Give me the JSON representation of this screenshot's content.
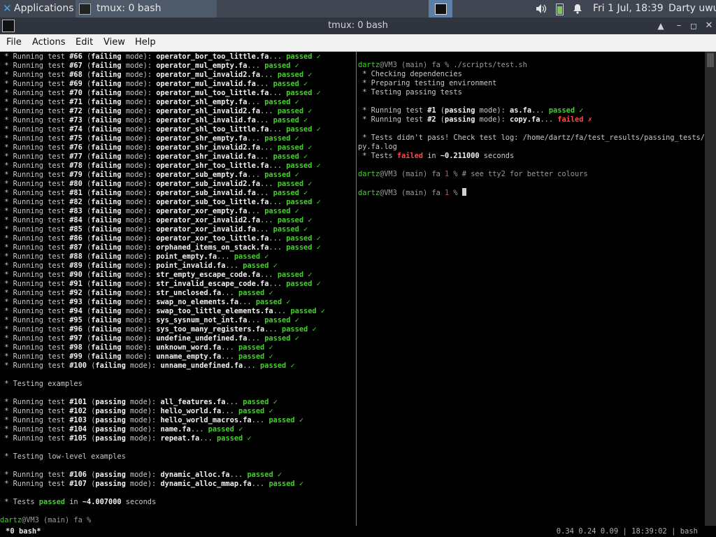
{
  "panel": {
    "apps_label": "Applications",
    "task_label": "tmux: 0 bash",
    "clock": "Fri  1 Jul, 18:39",
    "user": "Darty uwu"
  },
  "window": {
    "title": "tmux: 0 bash",
    "buttons": {
      "shade": "▲",
      "minimize": "–",
      "maximize": "◻",
      "close": "✕"
    }
  },
  "menu": [
    "File",
    "Actions",
    "Edit",
    "View",
    "Help"
  ],
  "left_pane": {
    "tests": [
      {
        "n": "66",
        "mode": "failing",
        "file": "operator_bor_too_little.fa"
      },
      {
        "n": "67",
        "mode": "failing",
        "file": "operator_mul_empty.fa"
      },
      {
        "n": "68",
        "mode": "failing",
        "file": "operator_mul_invalid2.fa"
      },
      {
        "n": "69",
        "mode": "failing",
        "file": "operator_mul_invalid.fa"
      },
      {
        "n": "70",
        "mode": "failing",
        "file": "operator_mul_too_little.fa"
      },
      {
        "n": "71",
        "mode": "failing",
        "file": "operator_shl_empty.fa"
      },
      {
        "n": "72",
        "mode": "failing",
        "file": "operator_shl_invalid2.fa"
      },
      {
        "n": "73",
        "mode": "failing",
        "file": "operator_shl_invalid.fa"
      },
      {
        "n": "74",
        "mode": "failing",
        "file": "operator_shl_too_little.fa"
      },
      {
        "n": "75",
        "mode": "failing",
        "file": "operator_shr_empty.fa"
      },
      {
        "n": "76",
        "mode": "failing",
        "file": "operator_shr_invalid2.fa"
      },
      {
        "n": "77",
        "mode": "failing",
        "file": "operator_shr_invalid.fa"
      },
      {
        "n": "78",
        "mode": "failing",
        "file": "operator_shr_too_little.fa"
      },
      {
        "n": "79",
        "mode": "failing",
        "file": "operator_sub_empty.fa"
      },
      {
        "n": "80",
        "mode": "failing",
        "file": "operator_sub_invalid2.fa"
      },
      {
        "n": "81",
        "mode": "failing",
        "file": "operator_sub_invalid.fa"
      },
      {
        "n": "82",
        "mode": "failing",
        "file": "operator_sub_too_little.fa"
      },
      {
        "n": "83",
        "mode": "failing",
        "file": "operator_xor_empty.fa"
      },
      {
        "n": "84",
        "mode": "failing",
        "file": "operator_xor_invalid2.fa"
      },
      {
        "n": "85",
        "mode": "failing",
        "file": "operator_xor_invalid.fa"
      },
      {
        "n": "86",
        "mode": "failing",
        "file": "operator_xor_too_little.fa"
      },
      {
        "n": "87",
        "mode": "failing",
        "file": "orphaned_items_on_stack.fa"
      },
      {
        "n": "88",
        "mode": "failing",
        "file": "point_empty.fa"
      },
      {
        "n": "89",
        "mode": "failing",
        "file": "point_invalid.fa"
      },
      {
        "n": "90",
        "mode": "failing",
        "file": "str_empty_escape_code.fa"
      },
      {
        "n": "91",
        "mode": "failing",
        "file": "str_invalid_escape_code.fa"
      },
      {
        "n": "92",
        "mode": "failing",
        "file": "str_unclosed.fa"
      },
      {
        "n": "93",
        "mode": "failing",
        "file": "swap_no_elements.fa"
      },
      {
        "n": "94",
        "mode": "failing",
        "file": "swap_too_little_elements.fa"
      },
      {
        "n": "95",
        "mode": "failing",
        "file": "sys_sysnum_not_int.fa"
      },
      {
        "n": "96",
        "mode": "failing",
        "file": "sys_too_many_registers.fa"
      },
      {
        "n": "97",
        "mode": "failing",
        "file": "undefine_undefined.fa"
      },
      {
        "n": "98",
        "mode": "failing",
        "file": "unknown_word.fa"
      },
      {
        "n": "99",
        "mode": "failing",
        "file": "unname_empty.fa"
      },
      {
        "n": "100",
        "mode": "failing",
        "file": "unname_undefined.fa"
      }
    ],
    "examples_header": " * Testing examples",
    "examples": [
      {
        "n": "101",
        "mode": "passing",
        "file": "all_features.fa"
      },
      {
        "n": "102",
        "mode": "passing",
        "file": "hello_world.fa"
      },
      {
        "n": "103",
        "mode": "passing",
        "file": "hello_world_macros.fa"
      },
      {
        "n": "104",
        "mode": "passing",
        "file": "name.fa"
      },
      {
        "n": "105",
        "mode": "passing",
        "file": "repeat.fa"
      }
    ],
    "lowlevel_header": " * Testing low-level examples",
    "lowlevel": [
      {
        "n": "106",
        "mode": "passing",
        "file": "dynamic_alloc.fa"
      },
      {
        "n": "107",
        "mode": "passing",
        "file": "dynamic_alloc_mmap.fa"
      }
    ],
    "summary_prefix": " * Tests ",
    "summary_status": "passed",
    "summary_mid": " in ",
    "summary_time": "~4.007000",
    "summary_suffix": " seconds",
    "prompt_user": "dartz",
    "prompt_rest": "@VM3 (main) fa %"
  },
  "right_pane": {
    "prompt_user": "dartz",
    "prompt_host": "@VM3 (main) fa",
    "command": " % ./scripts/test.sh",
    "info_lines": [
      " * Checking dependencies",
      " * Preparing testing environment",
      " * Testing passing tests"
    ],
    "tests": [
      {
        "n": "1",
        "mode": "passing",
        "file": "as.fa",
        "status": "passed",
        "mark": "✓"
      },
      {
        "n": "2",
        "mode": "passing",
        "file": "copy.fa",
        "status": "failed",
        "mark": "✗"
      }
    ],
    "fail_line_1": " * Tests didn't pass! Check test log: /home/dartz/fa/test_results/passing_tests/co",
    "fail_line_2": "py.fa.log",
    "fail_summary_prefix": " * Tests ",
    "fail_summary_status": "failed",
    "fail_summary_mid": " in ",
    "fail_summary_time": "~0.211000",
    "fail_summary_suffix": " seconds",
    "exit_code": "1",
    "comment_cmd": " % # see tty2 for better colours",
    "prompt_end": " %"
  },
  "status_bar": {
    "left": " *0 bash*",
    "right": "0.34 0.24 0.09 | 18:39:02 | bash"
  }
}
